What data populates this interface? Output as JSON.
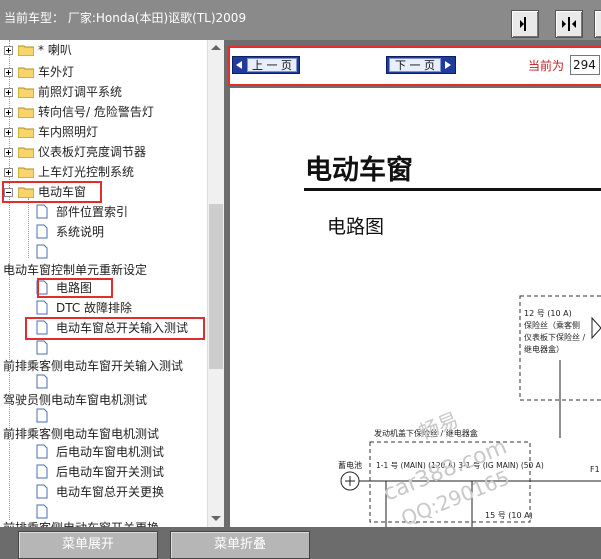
{
  "header": {
    "title": "当前车型： 厂家:Honda(本田)讴歌(TL)2009",
    "buttons": [
      {
        "icon": "collapse-left-icon"
      },
      {
        "icon": "split-view-icon"
      }
    ]
  },
  "tree": {
    "items": [
      {
        "label": "* 喇叭"
      },
      {
        "label": "车外灯"
      },
      {
        "label": "前照灯调平系统"
      },
      {
        "label": "转向信号/ 危险警告灯"
      },
      {
        "label": "车内照明灯"
      },
      {
        "label": "仪表板灯亮度调节器"
      },
      {
        "label": "上车灯光控制系统"
      },
      {
        "label": "电动车窗"
      },
      {
        "label": "部件位置索引"
      },
      {
        "label": "系统说明"
      },
      {
        "label": ""
      },
      {
        "label": "电动车窗控制单元重新设定"
      },
      {
        "label": "电路图"
      },
      {
        "label": "DTC 故障排除"
      },
      {
        "label": "电动车窗总开关输入测试"
      },
      {
        "label": ""
      },
      {
        "label": "前排乘客侧电动车窗开关输入测试"
      },
      {
        "label": ""
      },
      {
        "label": "驾驶员侧电动车窗电机测试"
      },
      {
        "label": ""
      },
      {
        "label": "前排乘客侧电动车窗电机测试"
      },
      {
        "label": "后电动车窗电机测试"
      },
      {
        "label": "后电动车窗开关测试"
      },
      {
        "label": "电动车窗总开关更换"
      },
      {
        "label": ""
      },
      {
        "label": "前排乘客侧电动车窗开关更换"
      }
    ]
  },
  "nav": {
    "prev_label": "上 一 页",
    "next_label": "下 一 页",
    "page_label": "当前为",
    "page_value": "294"
  },
  "document": {
    "title": "电动车窗",
    "subtitle": "电路图",
    "fuse1_line1": "12 号 (10 A)",
    "fuse1_line2": "保险丝（乘客侧",
    "fuse1_line3": "仪表板下保险丝 /",
    "fuse1_line4": "继电器盒）",
    "underhood_label": "发动机盖下保险丝 / 继电器盒",
    "battery_label": "蓄电池",
    "fuse_row": "1-1 号 (MAIN) (120 A)  3-1 号 (IG MAIN) (50 A)",
    "fuse_f1": "F1",
    "fuse_15": "15 号 (10 A)",
    "watermark1": "畅易",
    "watermark2": "car388.com",
    "watermark3": "QQ:290165"
  },
  "footer": {
    "expand_label": "菜单展开",
    "collapse_label": "菜单折叠"
  }
}
